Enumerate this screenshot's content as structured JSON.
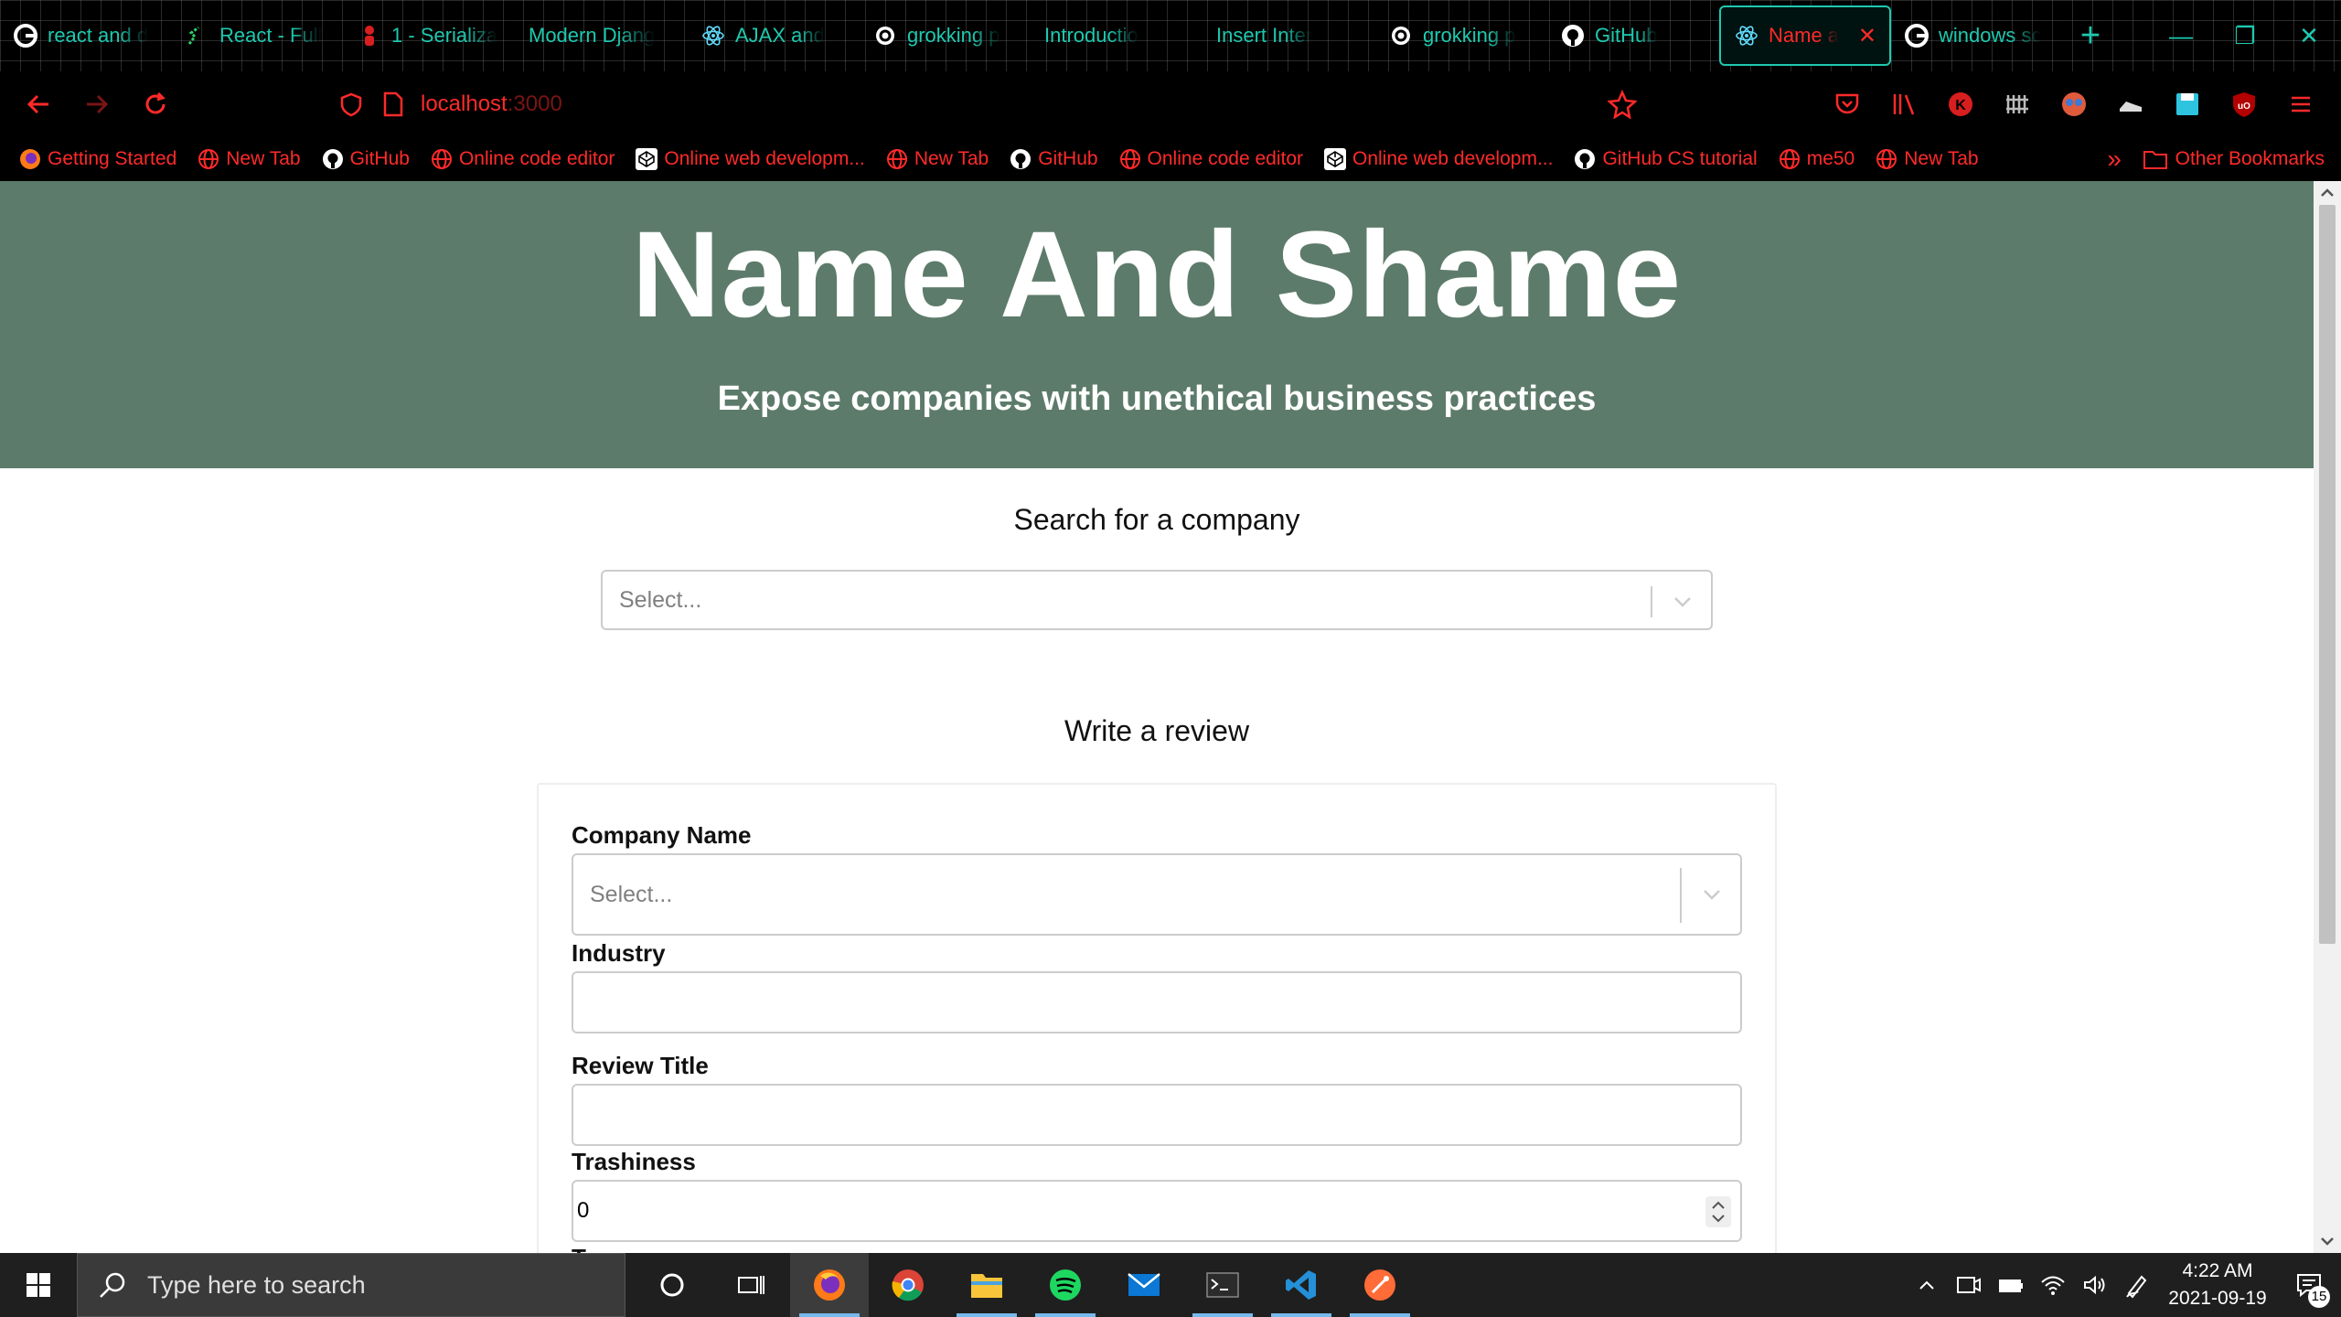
{
  "browser": {
    "tabs": [
      {
        "title": "react and d",
        "icon": "google-icon"
      },
      {
        "title": "React - Full",
        "icon": "react-full-icon"
      },
      {
        "title": "1 - Serializa",
        "icon": "person-icon"
      },
      {
        "title": "Modern Djang",
        "icon": "none"
      },
      {
        "title": "AJAX and",
        "icon": "react-icon"
      },
      {
        "title": "grokking p",
        "icon": "swirl-icon"
      },
      {
        "title": "Introductio",
        "icon": "none"
      },
      {
        "title": "Insert Inter",
        "icon": "none"
      },
      {
        "title": "grokking p",
        "icon": "swirl-icon"
      },
      {
        "title": "GitHub",
        "icon": "github-icon"
      },
      {
        "title": "Name a",
        "icon": "react-icon",
        "active": true
      },
      {
        "title": "windows sc",
        "icon": "google-icon"
      }
    ],
    "new_tab_label": "+",
    "url": {
      "host": "localhost",
      "port": ":3000"
    },
    "bookmarks": [
      {
        "label": "Getting Started",
        "icon": "firefox-icon"
      },
      {
        "label": "New Tab",
        "icon": "globe-icon"
      },
      {
        "label": "GitHub",
        "icon": "github-icon"
      },
      {
        "label": "Online code editor",
        "icon": "globe-icon"
      },
      {
        "label": "Online web developm...",
        "icon": "codepen-icon"
      },
      {
        "label": "New Tab",
        "icon": "globe-icon"
      },
      {
        "label": "GitHub",
        "icon": "github-icon"
      },
      {
        "label": "Online code editor",
        "icon": "globe-icon"
      },
      {
        "label": "Online web developm...",
        "icon": "codepen-icon"
      },
      {
        "label": "GitHub CS tutorial",
        "icon": "github-icon"
      },
      {
        "label": "me50",
        "icon": "globe-icon"
      },
      {
        "label": "New Tab",
        "icon": "globe-icon"
      }
    ],
    "more_bookmarks": "»",
    "other_bookmarks": "Other Bookmarks",
    "accent_color": "#1ec9b0",
    "bookmark_color": "#ff2a2a"
  },
  "page": {
    "title": "Name And Shame",
    "subtitle": "Expose companies with unethical business practices",
    "header_color": "#5d7b6a",
    "search": {
      "heading": "Search for a company",
      "placeholder": "Select..."
    },
    "review": {
      "heading": "Write a review",
      "company_label": "Company Name",
      "company_placeholder": "Select...",
      "industry_label": "Industry",
      "industry_value": "",
      "review_title_label": "Review Title",
      "review_title_value": "",
      "trashiness_label": "Trashiness",
      "trashiness_value": "0",
      "tags_label": "Tags"
    }
  },
  "taskbar": {
    "search_placeholder": "Type here to search",
    "apps": [
      "cortana-icon",
      "task-view-icon",
      "firefox-icon",
      "chrome-icon",
      "file-explorer-icon",
      "spotify-icon",
      "mail-icon",
      "terminal-icon",
      "vscode-icon",
      "postman-icon"
    ],
    "time": "4:22 AM",
    "date": "2021-09-19",
    "notification_count": "15"
  }
}
